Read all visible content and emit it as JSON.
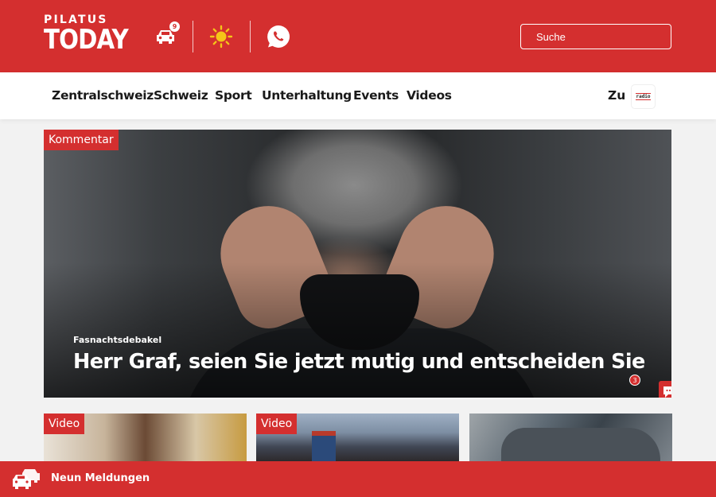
{
  "header": {
    "logo_top": "PILATUS",
    "logo_bottom": "TODAY",
    "traffic_count": "9",
    "search_placeholder": "Suche"
  },
  "nav": {
    "items": [
      "Zentralschweiz",
      "Schweiz",
      "Sport",
      "Unterhaltung",
      "Events",
      "Videos"
    ],
    "zu_label": "Zu",
    "radio_logo_text": "radio"
  },
  "hero": {
    "tag": "Kommentar",
    "kicker": "Fasnachtsdebakel",
    "title": "Herr Graf, seien Sie jetzt mutig und entscheiden Sie",
    "comment_count": "3"
  },
  "cards": [
    {
      "tag": "Video"
    },
    {
      "tag": "Video"
    },
    {
      "tag": ""
    }
  ],
  "bottom_bar": {
    "label": "Neun Meldungen"
  },
  "colors": {
    "brand_red": "#d42f2f",
    "nav_text": "#1a1a1a",
    "white": "#ffffff"
  }
}
